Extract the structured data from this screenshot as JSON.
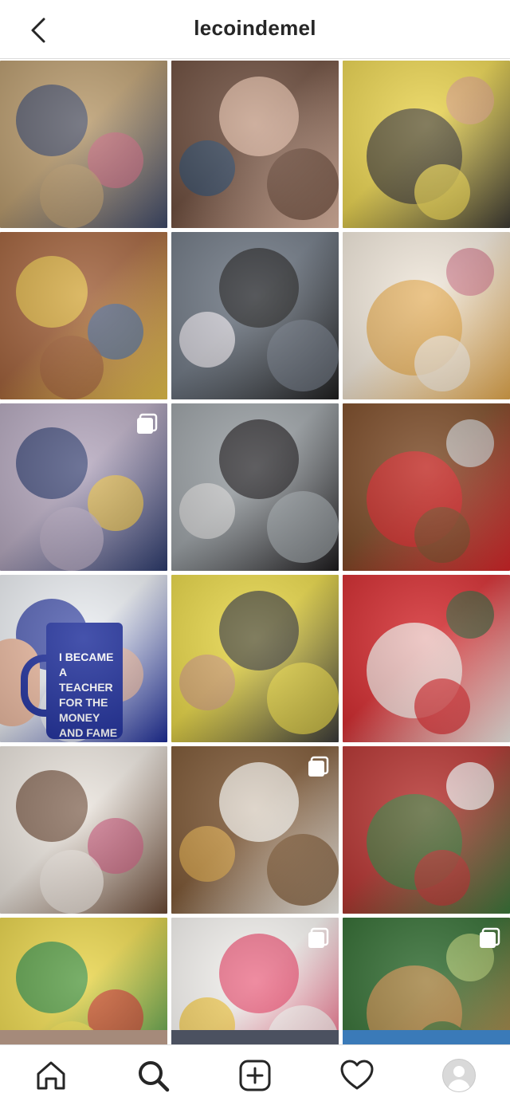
{
  "header": {
    "title": "lecoindemel"
  },
  "grid": {
    "tiles": [
      {
        "name": "photo-kids-playing-living-room",
        "colors": [
          "#b89a6c",
          "#3e4a6b",
          "#c46a7d"
        ],
        "multi": false
      },
      {
        "name": "photo-selfie-with-kids",
        "colors": [
          "#6b4b3b",
          "#e0b9a4",
          "#2e4a6a"
        ],
        "multi": false
      },
      {
        "name": "photo-woman-yellow-cardigan-car",
        "colors": [
          "#e9d34f",
          "#3d3a34",
          "#d9a17f"
        ],
        "multi": false
      },
      {
        "name": "photo-kids-with-gifts-brick-wall",
        "colors": [
          "#a0603a",
          "#e6c34a",
          "#4c6b9a"
        ],
        "multi": false
      },
      {
        "name": "photo-boy-holding-drawing",
        "colors": [
          "#6d7682",
          "#1f1f1f",
          "#e8e4ea"
        ],
        "multi": false
      },
      {
        "name": "photo-pancake-breakfast-spread",
        "colors": [
          "#f0e7da",
          "#e3a84c",
          "#cf7c8c"
        ],
        "multi": false
      },
      {
        "name": "photo-kids-on-bed",
        "colors": [
          "#b4a7bd",
          "#2c3b6e",
          "#e8c04a"
        ],
        "multi": true
      },
      {
        "name": "photo-black-cat-on-cushion",
        "colors": [
          "#9aa0a4",
          "#1c1a1c",
          "#d6d6d6"
        ],
        "multi": false
      },
      {
        "name": "photo-red-screw-organizer",
        "colors": [
          "#7b4a26",
          "#d8262a",
          "#c7c7c7"
        ],
        "multi": false
      },
      {
        "name": "photo-blue-teacher-mug",
        "colors": [
          "#ebeef2",
          "#1d2d9a",
          "#e9b89f"
        ],
        "multi": false,
        "mug_text": [
          "I BECAME",
          "A TEACHER",
          "FOR THE",
          "MONEY",
          "AND FAME"
        ]
      },
      {
        "name": "photo-woman-yellow-cardigan-tshirt",
        "colors": [
          "#e7d646",
          "#3a3a3a",
          "#cf9b7a"
        ],
        "multi": false
      },
      {
        "name": "photo-family-santa-hats",
        "colors": [
          "#d3292d",
          "#f2efe9",
          "#3a5a34"
        ],
        "multi": false
      },
      {
        "name": "photo-kids-gingerbread-house",
        "colors": [
          "#e9e3dc",
          "#6b4a35",
          "#c45a7a"
        ],
        "multi": false
      },
      {
        "name": "photo-pasta-dish-wooden-table",
        "colors": [
          "#7b5532",
          "#f7f5f0",
          "#d9a64a"
        ],
        "multi": true
      },
      {
        "name": "photo-kids-christmas-pajamas",
        "colors": [
          "#b5322f",
          "#3c7a3c",
          "#f0f0f0"
        ],
        "multi": false
      },
      {
        "name": "photo-woman-elf-hat-car",
        "colors": [
          "#e8d44a",
          "#2d8c4a",
          "#c73a2e"
        ],
        "multi": false
      },
      {
        "name": "photo-colorful-candies",
        "colors": [
          "#f4f2ef",
          "#e8486b",
          "#f2c43a"
        ],
        "multi": true
      },
      {
        "name": "photo-burger-in-hand-ivy",
        "colors": [
          "#2f6a2f",
          "#c98b4a",
          "#a7c26a"
        ],
        "multi": true
      }
    ],
    "partial_colors": [
      "#a58a7a",
      "#4b5160",
      "#3a7ab8"
    ]
  },
  "tabbar": {
    "items": [
      {
        "name": "home-tab",
        "icon": "home-icon"
      },
      {
        "name": "search-tab",
        "icon": "search-icon"
      },
      {
        "name": "new-post-tab",
        "icon": "plus-square-icon"
      },
      {
        "name": "activity-tab",
        "icon": "heart-icon"
      },
      {
        "name": "profile-tab",
        "icon": "avatar-icon"
      }
    ]
  }
}
